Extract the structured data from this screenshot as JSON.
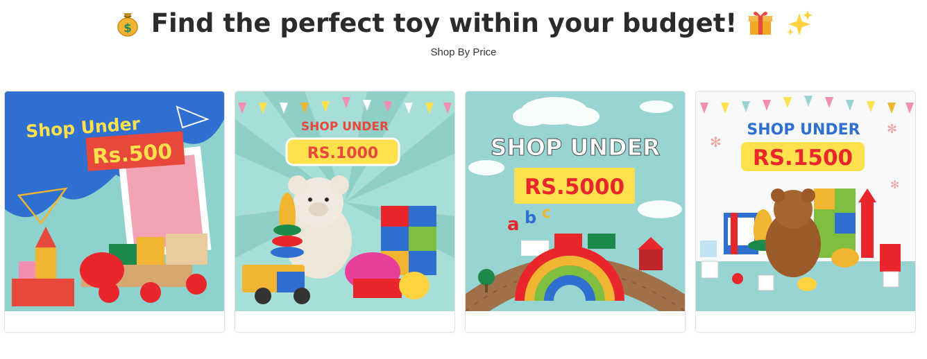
{
  "header": {
    "title": "Find the perfect toy within your budget!",
    "subtitle": "Shop By Price",
    "icons": [
      "money-bag-icon",
      "gift-icon",
      "sparkles-icon"
    ]
  },
  "cards": [
    {
      "line1": "Shop Under",
      "line2": "Rs.500"
    },
    {
      "line1": "SHOP UNDER",
      "line2": "RS.1000"
    },
    {
      "line1": "SHOP UNDER",
      "line2": "RS.5000"
    },
    {
      "line1": "SHOP UNDER",
      "line2": "RS.1500"
    }
  ],
  "colors": {
    "teal": "#8fd2cd",
    "blue": "#2f6fcf",
    "yellow": "#ffe04d",
    "red": "#e8473c",
    "title": "#2b2b2b"
  }
}
